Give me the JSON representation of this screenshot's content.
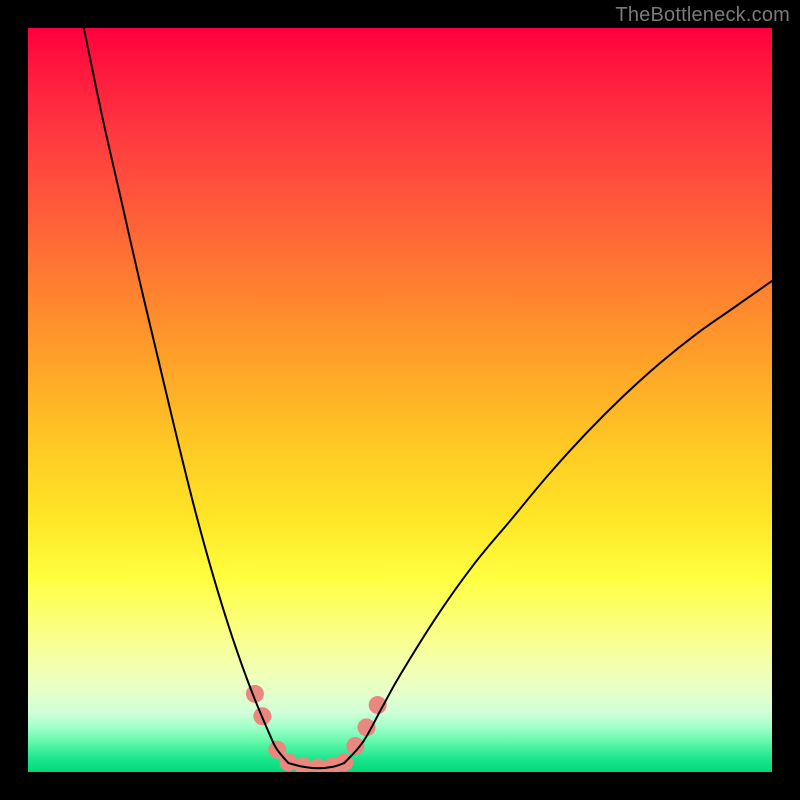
{
  "watermark": "TheBottleneck.com",
  "chart_data": {
    "type": "line",
    "title": "",
    "xlabel": "",
    "ylabel": "",
    "xlim": [
      0,
      100
    ],
    "ylim": [
      0,
      100
    ],
    "grid": false,
    "legend": false,
    "background_gradient": {
      "top": "#ff003f",
      "mid": "#ffff40",
      "bottom": "#00d878"
    },
    "series": [
      {
        "name": "left-curve",
        "color": "#000000",
        "stroke_width": 2,
        "x": [
          7.5,
          10,
          12.5,
          15,
          17.5,
          20,
          22.5,
          25,
          27.5,
          30,
          32.5,
          33.5,
          35
        ],
        "y": [
          100,
          88,
          77,
          66,
          55.5,
          45,
          35,
          26,
          18,
          11,
          5,
          3,
          1.2
        ]
      },
      {
        "name": "bottom-flat",
        "color": "#000000",
        "stroke_width": 2,
        "x": [
          35,
          37,
          39,
          41,
          42.5
        ],
        "y": [
          1.2,
          0.7,
          0.5,
          0.7,
          1.2
        ]
      },
      {
        "name": "right-curve",
        "color": "#000000",
        "stroke_width": 2,
        "x": [
          42.5,
          45,
          47.5,
          50,
          55,
          60,
          65,
          70,
          75,
          80,
          85,
          90,
          95,
          100
        ],
        "y": [
          1.2,
          4,
          8.5,
          13,
          21,
          28,
          34,
          40,
          45.5,
          50.5,
          55,
          59,
          62.5,
          66
        ]
      }
    ],
    "markers": [
      {
        "name": "highlight-dots",
        "color": "#e9887f",
        "radius": 9,
        "points": [
          {
            "x": 30.5,
            "y": 10.5
          },
          {
            "x": 31.5,
            "y": 7.5
          },
          {
            "x": 33.5,
            "y": 3.0
          },
          {
            "x": 35.0,
            "y": 1.3
          },
          {
            "x": 37.0,
            "y": 0.8
          },
          {
            "x": 39.0,
            "y": 0.6
          },
          {
            "x": 41.0,
            "y": 0.8
          },
          {
            "x": 42.5,
            "y": 1.3
          },
          {
            "x": 44.0,
            "y": 3.5
          },
          {
            "x": 45.5,
            "y": 6.0
          },
          {
            "x": 47.0,
            "y": 9.0
          }
        ]
      }
    ]
  }
}
